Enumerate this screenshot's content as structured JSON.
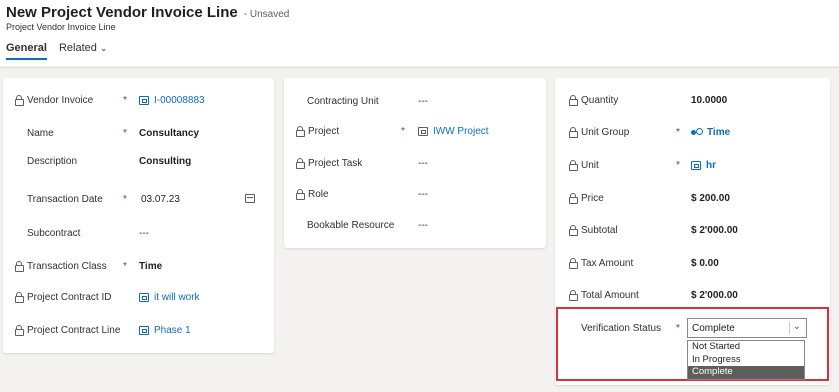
{
  "header": {
    "title": "New Project Vendor Invoice Line",
    "status": "- Unsaved",
    "subtitle": "Project Vendor Invoice Line",
    "tabs": [
      {
        "label": "General",
        "active": true
      },
      {
        "label": "Related",
        "active": false
      }
    ]
  },
  "colors": {
    "accent": "#0f6cbd",
    "required": "#a4262c",
    "highlight_border": "#d13438"
  },
  "left_card": {
    "vendor_invoice": {
      "label": "Vendor Invoice",
      "value": "I-00008883"
    },
    "name": {
      "label": "Name",
      "value": "Consultancy"
    },
    "description": {
      "label": "Description",
      "value": "Consulting"
    },
    "transaction_date": {
      "label": "Transaction Date",
      "value": "03.07.23"
    },
    "subcontract": {
      "label": "Subcontract",
      "value": "---"
    },
    "transaction_class": {
      "label": "Transaction Class",
      "value": "Time"
    },
    "project_contract_id": {
      "label": "Project Contract ID",
      "value": "it will work"
    },
    "project_contract_line": {
      "label": "Project Contract Line",
      "value": "Phase 1"
    }
  },
  "middle_card": {
    "contracting_unit": {
      "label": "Contracting Unit",
      "value": "---"
    },
    "project": {
      "label": "Project",
      "value": "IWW Project"
    },
    "project_task": {
      "label": "Project Task",
      "value": "---"
    },
    "role": {
      "label": "Role",
      "value": "---"
    },
    "bookable_resource": {
      "label": "Bookable Resource",
      "value": "---"
    }
  },
  "right_card": {
    "quantity": {
      "label": "Quantity",
      "value": "10.0000"
    },
    "unit_group": {
      "label": "Unit Group",
      "value": "Time"
    },
    "unit": {
      "label": "Unit",
      "value": "hr"
    },
    "price": {
      "label": "Price",
      "value": "$ 200.00"
    },
    "subtotal": {
      "label": "Subtotal",
      "value": "$ 2'000.00"
    },
    "tax_amount": {
      "label": "Tax Amount",
      "value": "$ 0.00"
    },
    "total_amount": {
      "label": "Total Amount",
      "value": "$ 2'000.00"
    },
    "verification_status": {
      "label": "Verification Status",
      "value": "Complete",
      "options": [
        "Not Started",
        "In Progress",
        "Complete"
      ]
    }
  },
  "required_marker": "*"
}
